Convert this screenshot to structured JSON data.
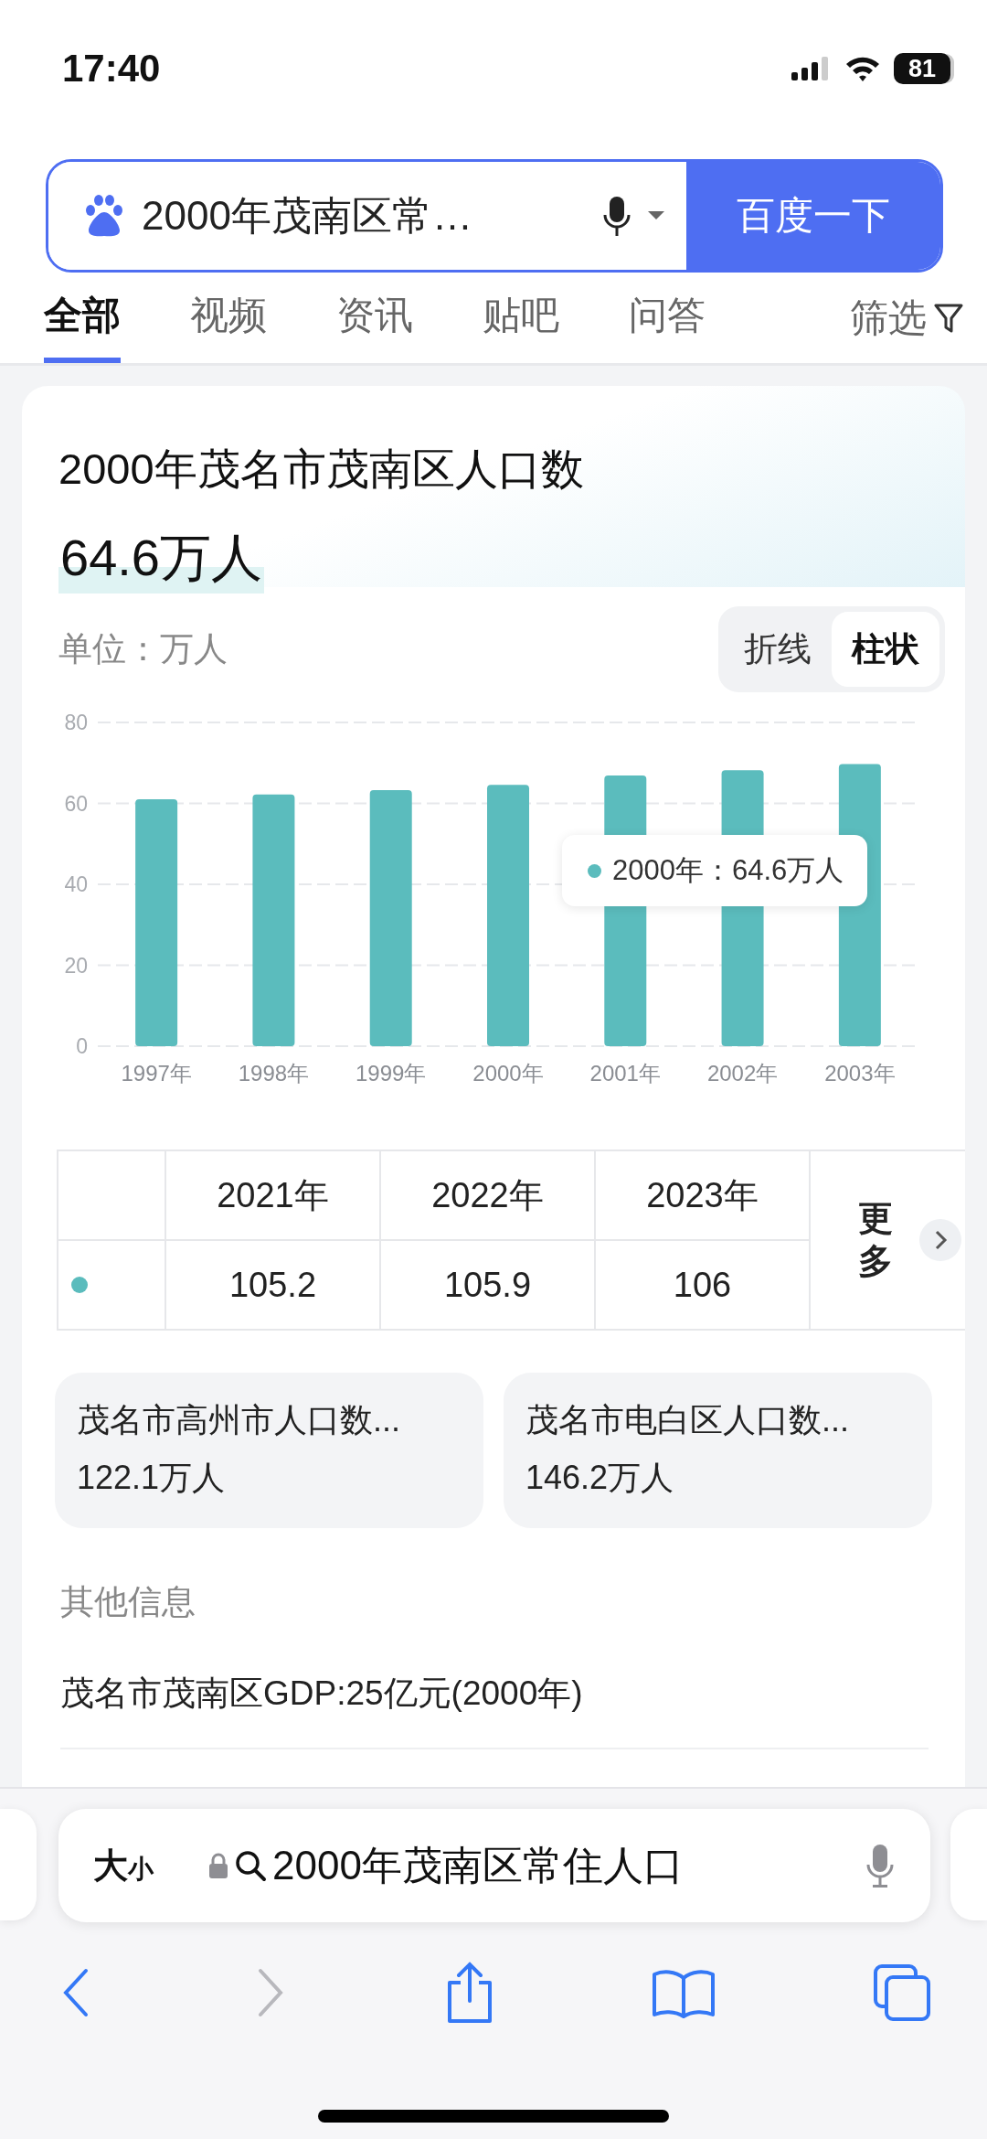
{
  "status_bar": {
    "time": "17:40",
    "battery": "81"
  },
  "search": {
    "value": "2000年茂南区常…",
    "button": "百度一下"
  },
  "tabs": [
    {
      "label": "全部",
      "selected": true
    },
    {
      "label": "视频",
      "selected": false
    },
    {
      "label": "资讯",
      "selected": false
    },
    {
      "label": "贴吧",
      "selected": false
    },
    {
      "label": "问答",
      "selected": false
    }
  ],
  "filter": "筛选",
  "result_card": {
    "title": "2000年茂名市茂南区人口数",
    "value": "64.6万人",
    "unit": "单位：万人",
    "chart_types": [
      {
        "label": "折线",
        "selected": false
      },
      {
        "label": "柱状",
        "selected": true
      }
    ],
    "chart_data": {
      "type": "bar",
      "categories": [
        "1997年",
        "1998年",
        "1999年",
        "2000年",
        "2001年",
        "2002年",
        "2003年"
      ],
      "series": [
        {
          "color": "#5bbcbd",
          "values": [
            61.0,
            62.2,
            63.3,
            64.6,
            66.9,
            68.2,
            69.7
          ]
        }
      ],
      "ylim": [
        0,
        80
      ],
      "yticks": [
        0,
        20,
        40,
        60,
        80
      ],
      "grid": true
    },
    "chart_tooltip": {
      "category": "2000年",
      "value": "：64.6万人"
    },
    "table": {
      "columns": [
        "2021年",
        "2022年",
        "2023年"
      ],
      "row": {
        "color": "#5bbcbd",
        "values": [
          "105.2",
          "105.9",
          "106"
        ]
      },
      "more": "更多"
    },
    "related": [
      {
        "title": "茂名市高州市人口数...",
        "value": "122.1万人"
      },
      {
        "title": "茂名市电白区人口数...",
        "value": "146.2万人"
      }
    ],
    "other_info": {
      "heading": "其他信息",
      "items": [
        "茂名市茂南区GDP:25亿元(2000年)"
      ]
    }
  },
  "address_bar": {
    "text_size": "大小",
    "query": "2000年茂南区常住人口"
  }
}
